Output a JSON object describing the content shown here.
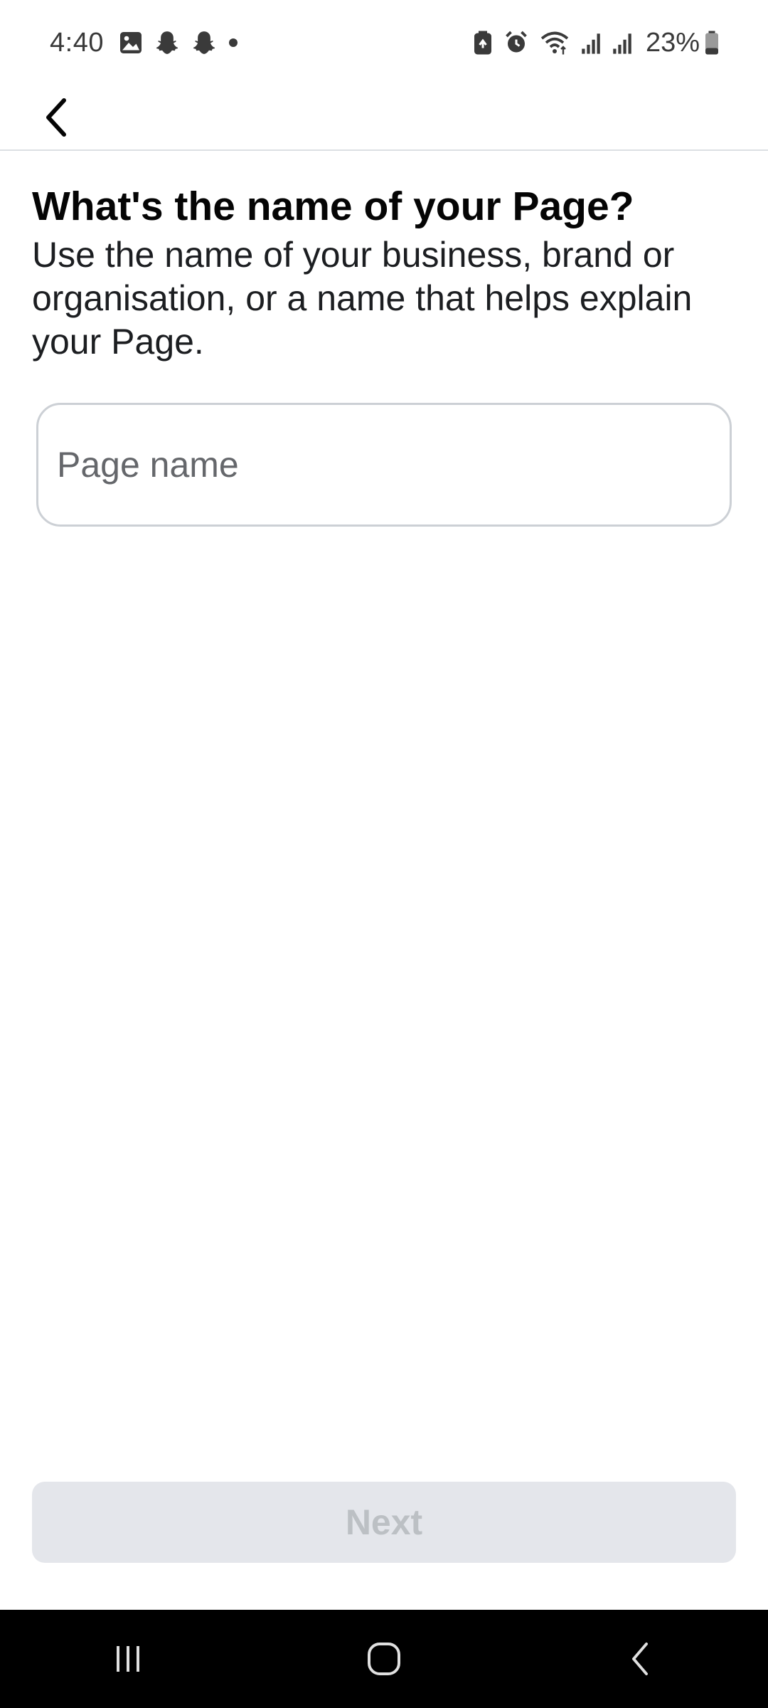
{
  "status_bar": {
    "time": "4:40",
    "battery_percent": "23%",
    "left_icons": [
      "gallery-icon",
      "snapchat-icon",
      "snapchat-icon",
      "notification-dot-icon"
    ],
    "right_icons": [
      "battery-saver-icon",
      "alarm-icon",
      "wifi-icon",
      "signal-icon",
      "signal-icon",
      "battery-icon"
    ]
  },
  "header": {
    "back_icon": "chevron-left-icon"
  },
  "main": {
    "title": "What's the name of your Page?",
    "subtitle": "Use the name of your business, brand or organisation, or a name that helps explain your Page.",
    "page_name_input": {
      "placeholder": "Page name",
      "value": ""
    }
  },
  "footer": {
    "next_label": "Next",
    "next_enabled": false
  },
  "nav_bar": {
    "icons": [
      "recent-apps-icon",
      "home-icon",
      "back-icon"
    ]
  },
  "colors": {
    "text_primary": "#050505",
    "input_border": "#ccd0d5",
    "button_disabled_bg": "#e4e6eb",
    "button_disabled_text": "#bcc0c4",
    "nav_bar_bg": "#000000"
  }
}
